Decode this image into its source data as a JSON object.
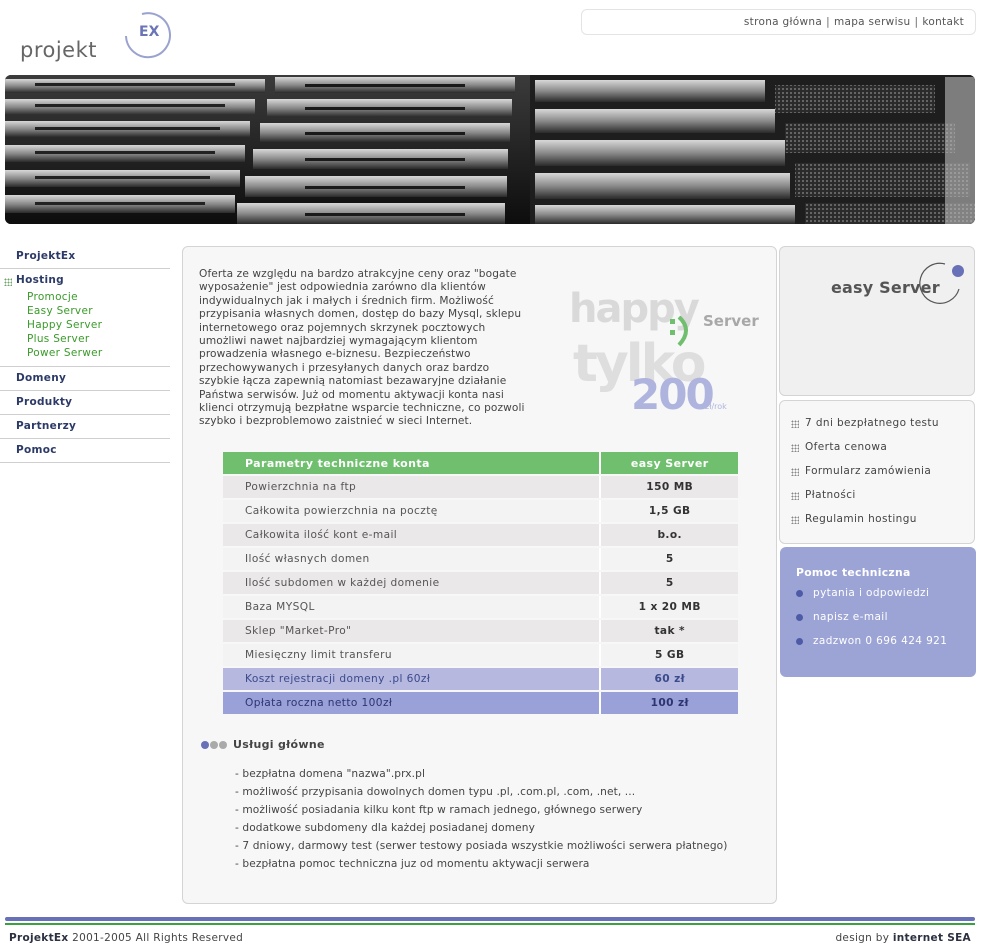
{
  "header": {
    "logo_text": "projekt",
    "logo_badge": "EX",
    "links": [
      "strona główna",
      "mapa serwisu",
      "kontakt"
    ],
    "separator": "|"
  },
  "nav": {
    "items_top": [
      {
        "label": "ProjektEx"
      }
    ],
    "hosting": {
      "label": "Hosting",
      "subitems": [
        "Promocje",
        "Easy Server",
        "Happy Server",
        "Plus Server",
        "Power Serwer"
      ]
    },
    "items_bottom": [
      {
        "label": "Domeny"
      },
      {
        "label": "Produkty"
      },
      {
        "label": "Partnerzy"
      },
      {
        "label": "Pomoc"
      }
    ]
  },
  "main": {
    "intro_lines": [
      "Oferta ze względu na bardzo atrakcyjne ceny oraz \"bogate",
      "wyposażenie\" jest odpowiednia zarówno dla klientów",
      "indywidualnych jak i małych i średnich firm. Możliwość",
      "przypisania własnych domen, dostęp do bazy Mysql, sklepu",
      "internetowego oraz pojemnych skrzynek pocztowych",
      "umożliwi nawet najbardziej wymagającym klientom",
      "prowadzenia własnego e-biznesu. Bezpieczeństwo",
      "przechowywanych i przesyłanych danych oraz bardzo",
      "szybkie łącza zapewnią natomiast bezawaryjne działanie",
      "Państwa serwisów. Już od momentu aktywacji konta nasi",
      "klienci otrzymują bezpłatne wsparcie techniczne, co pozwoli",
      "szybko i bezproblemowo zaistnieć w sieci Internet."
    ],
    "promo": {
      "word1": "happy",
      "word2": "Server",
      "word3": "tylko",
      "price": "200",
      "unit": "zł/rok"
    },
    "table": {
      "header": [
        "Parametry techniczne konta",
        "easy Server"
      ],
      "rows": [
        [
          "Powierzchnia na ftp",
          "150 MB"
        ],
        [
          "Całkowita powierzchnia na pocztę",
          "1,5 GB"
        ],
        [
          "Całkowita ilość kont e-mail",
          "b.o."
        ],
        [
          "Ilość własnych domen",
          "5"
        ],
        [
          "Ilość subdomen w każdej domenie",
          "5"
        ],
        [
          "Baza MYSQL",
          "1 x 20 MB"
        ],
        [
          "Sklep \"Market-Pro\"",
          "tak *"
        ],
        [
          "Miesięczny limit transferu",
          "5 GB"
        ]
      ],
      "cost_row": [
        "Koszt rejestracji domeny .pl  60zł",
        "60 zł"
      ],
      "fee_row": [
        "Opłata roczna netto  100zł",
        "100 zł"
      ]
    },
    "services": {
      "title": "Usługi główne",
      "items": [
        "- bezpłatna domena \"nazwa\".prx.pl",
        "- możliwość przypisania dowolnych domen typu .pl, .com.pl, .com, .net, ...",
        "- możliwość posiadania kilku kont ftp w ramach jednego, głównego serwery",
        "- dodatkowe subdomeny dla każdej posiadanej domeny",
        "- 7 dniowy, darmowy test (serwer testowy posiada wszystkie możliwości serwera płatnego)",
        "- bezpłatna pomoc techniczna juz od momentu aktywacji serwera"
      ]
    }
  },
  "right": {
    "product": "easy Server",
    "links": [
      "7 dni bezpłatnego testu",
      "Oferta cenowa",
      "Formularz zamówienia",
      "Płatności",
      "Regulamin hostingu"
    ],
    "help": {
      "title": "Pomoc techniczna",
      "items": [
        "pytania i odpowiedzi",
        "napisz e-mail",
        "zadzwon 0 696 424 921"
      ]
    }
  },
  "footer": {
    "brand": "ProjektEx",
    "copyright": " 2001-2005 All Rights Reserved",
    "design_prefix": "design by ",
    "design_by": "internet SEA"
  },
  "colors": {
    "accent_green": "#6fbf6f",
    "accent_blue": "#9ca4d6",
    "nav_text": "#2c3a68",
    "subnav_text": "#3a9a2a"
  }
}
